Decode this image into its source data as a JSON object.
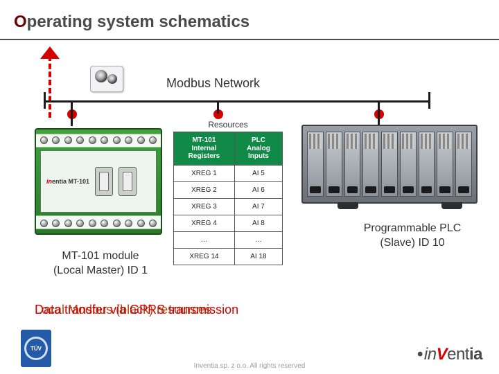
{
  "title_plain": "O",
  "title_rest": "perating system schematics",
  "network_label": "Modbus Network",
  "resources_title": "Resources",
  "table": {
    "headers": {
      "col1": "MT-101\nInternal\nRegisters",
      "col2": "PLC\nAnalog\nInputs"
    },
    "rows": [
      {
        "c1": "XREG 1",
        "c2": "AI 5"
      },
      {
        "c1": "XREG 2",
        "c2": "AI 6"
      },
      {
        "c1": "XREG 3",
        "c2": "AI 7"
      },
      {
        "c1": "XREG 4",
        "c2": "AI 8"
      },
      {
        "c1": "…",
        "c2": "…"
      },
      {
        "c1": "XREG 14",
        "c2": "AI 18"
      }
    ]
  },
  "left_caption_line1": "MT-101 module",
  "left_caption_line2": "(Local Master) ID 1",
  "right_caption_line1": "Programmable PLC",
  "right_caption_line2": "(Slave) ID 10",
  "device_label_prefix": "in",
  "device_label_suffix": "entia MT-101",
  "overlay": {
    "a": "Local Modbus (black) resources",
    "b": "Data transfer via GPRS transmission"
  },
  "footer": "Inventia sp. z o.o. All rights reserved",
  "tuv_text": "TÜV",
  "logo": {
    "dot": "•",
    "pre": "in",
    "v": "V",
    "post": "ent",
    "bold_tail": "ia"
  }
}
